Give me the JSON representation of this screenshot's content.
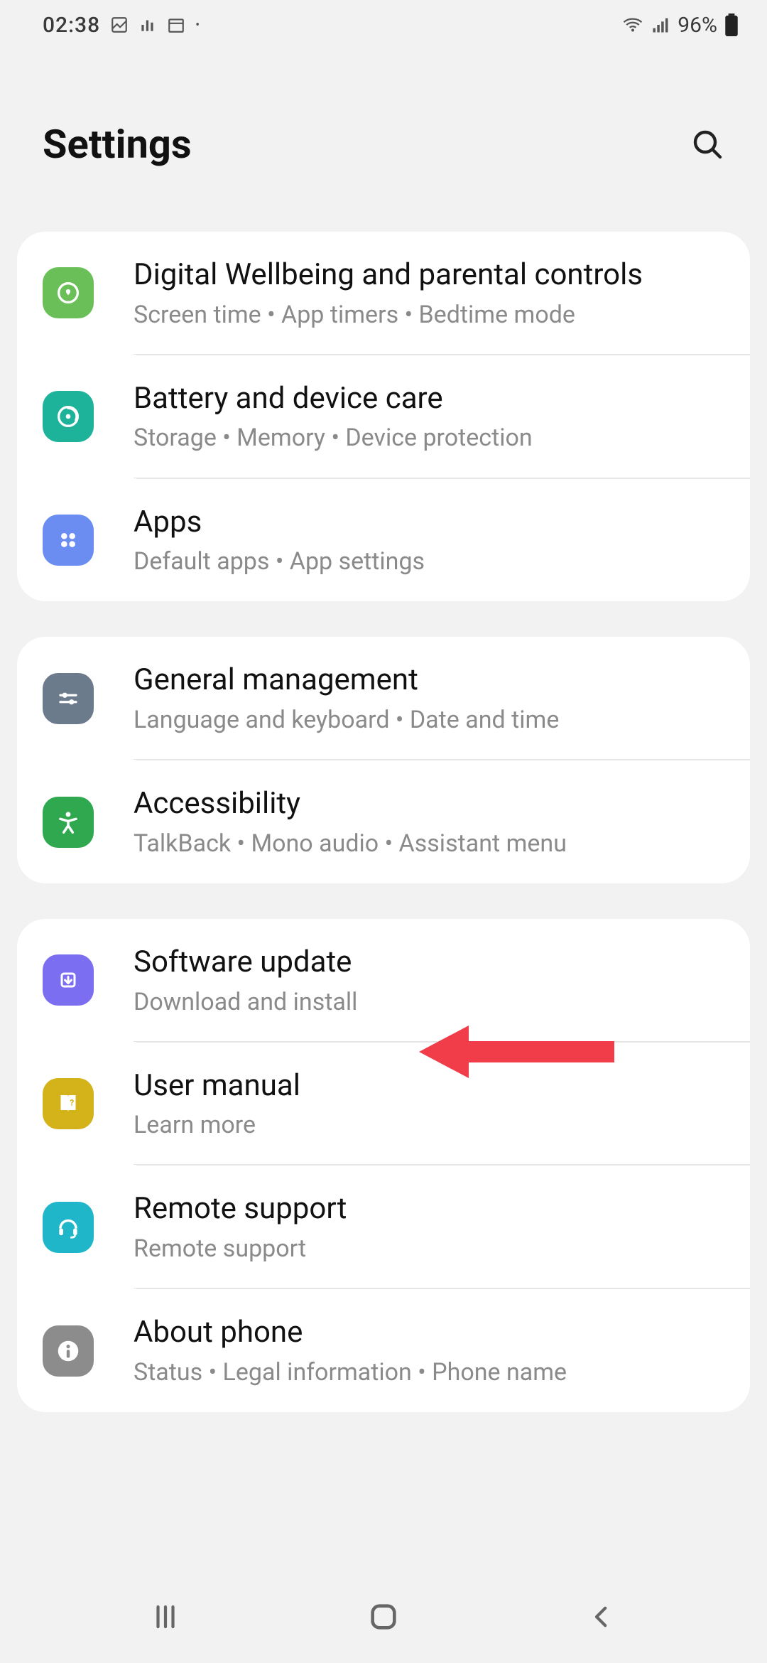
{
  "status": {
    "time": "02:38",
    "battery": "96%"
  },
  "header": {
    "title": "Settings"
  },
  "groups": [
    {
      "items": [
        {
          "title": "Digital Wellbeing and parental controls",
          "sub": "Screen time  •  App timers  •  Bedtime mode",
          "icon": "wellbeing",
          "color": "#6bbf59"
        },
        {
          "title": "Battery and device care",
          "sub": "Storage  •  Memory  •  Device protection",
          "icon": "battery-care",
          "color": "#1db29a"
        },
        {
          "title": "Apps",
          "sub": "Default apps  •  App settings",
          "icon": "apps",
          "color": "#6b8df2"
        }
      ]
    },
    {
      "items": [
        {
          "title": "General management",
          "sub": "Language and keyboard  •  Date and time",
          "icon": "sliders",
          "color": "#6b7b8c"
        },
        {
          "title": "Accessibility",
          "sub": "TalkBack  •  Mono audio  •  Assistant menu",
          "icon": "accessibility",
          "color": "#2fa84f"
        }
      ]
    },
    {
      "items": [
        {
          "title": "Software update",
          "sub": "Download and install",
          "icon": "update",
          "color": "#7b6ef0"
        },
        {
          "title": "User manual",
          "sub": "Learn more",
          "icon": "manual",
          "color": "#d4b21a"
        },
        {
          "title": "Remote support",
          "sub": "Remote support",
          "icon": "headset",
          "color": "#1fb6c9"
        },
        {
          "title": "About phone",
          "sub": "Status  •  Legal information  •  Phone name",
          "icon": "info",
          "color": "#8c8c8c"
        }
      ]
    }
  ]
}
